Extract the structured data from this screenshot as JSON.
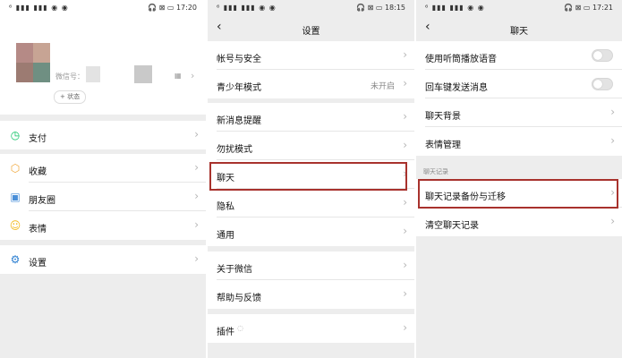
{
  "screen1": {
    "status": {
      "left": "⁶ ▮▮▮ ▮▮▮ ◉ ◉",
      "right": "🎧 ⊠ ▭ 17:20"
    },
    "profile": {
      "wechat_id_label": "微信号：",
      "status_button": "+ 状态"
    },
    "menu": [
      {
        "label": "支付",
        "icon": "pay-icon",
        "color": "#07c160"
      },
      {
        "label": "收藏",
        "icon": "favorites-icon",
        "color": "#f0a73a"
      },
      {
        "label": "朋友圈",
        "icon": "moments-icon",
        "color": "#4a8fd8"
      },
      {
        "label": "表情",
        "icon": "sticker-icon",
        "color": "#f2b91c"
      },
      {
        "label": "设置",
        "icon": "settings-icon",
        "color": "#2c7fd1"
      }
    ]
  },
  "screen2": {
    "status": {
      "left": "⁶ ▮▮▮ ▮▮▮ ◉ ◉",
      "right": "🎧 ⊠ ▭ 18:15"
    },
    "title": "设置",
    "items": [
      {
        "label": "帐号与安全",
        "value": ""
      },
      {
        "label": "青少年模式",
        "value": "未开启"
      },
      {
        "label": "新消息提醒",
        "value": ""
      },
      {
        "label": "勿扰模式",
        "value": ""
      },
      {
        "label": "聊天",
        "value": ""
      },
      {
        "label": "隐私",
        "value": ""
      },
      {
        "label": "通用",
        "value": ""
      },
      {
        "label": "关于微信",
        "value": ""
      },
      {
        "label": "帮助与反馈",
        "value": ""
      },
      {
        "label": "插件",
        "value": ""
      }
    ]
  },
  "screen3": {
    "status": {
      "left": "⁶ ▮▮▮ ▮▮▮ ◉ ◉",
      "right": "🎧 ⊠ ▭ 17:21"
    },
    "title": "聊天",
    "items": [
      {
        "label": "使用听筒播放语音",
        "toggle": "off"
      },
      {
        "label": "回车键发送消息",
        "toggle": "off"
      },
      {
        "label": "聊天背景"
      },
      {
        "label": "表情管理"
      }
    ],
    "section_caption": "聊天记录",
    "history_items": [
      {
        "label": "聊天记录备份与迁移"
      },
      {
        "label": "清空聊天记录"
      }
    ]
  },
  "colors": {
    "highlight": "#a8322d",
    "background": "#ededed"
  }
}
